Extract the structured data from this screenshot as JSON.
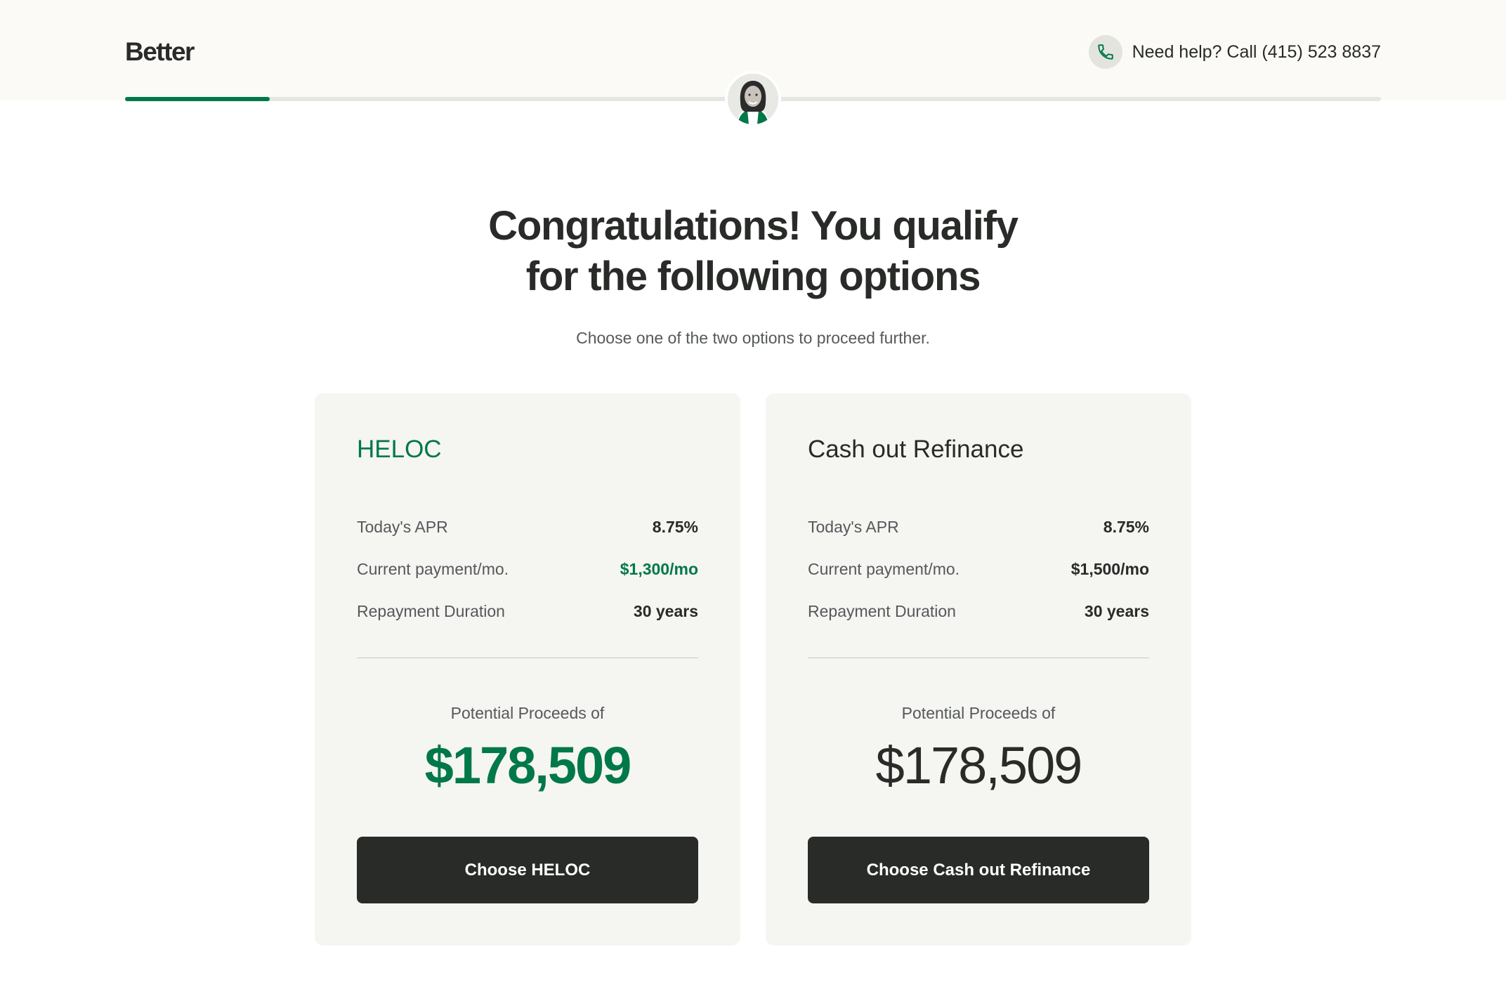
{
  "header": {
    "logo": "Better",
    "help_text": "Need help? Call (415) 523 8837",
    "phone_icon": "phone-icon",
    "avatar_icon": "agent-avatar"
  },
  "progress": {
    "fraction": 0.115,
    "fill_color": "#017848"
  },
  "main": {
    "title_line1": "Congratulations! You qualify",
    "title_line2": "for the following options",
    "subtitle": "Choose one of the two options to proceed further."
  },
  "options": [
    {
      "title": "HELOC",
      "rows": [
        {
          "label": "Today's APR",
          "value": "8.75%"
        },
        {
          "label": "Current payment/mo.",
          "value": "$1,300/mo"
        },
        {
          "label": "Repayment Duration",
          "value": "30 years"
        }
      ],
      "proceeds_label": "Potential Proceeds of",
      "proceeds_value": "$178,509",
      "button_label": "Choose HELOC"
    },
    {
      "title": "Cash out Refinance",
      "rows": [
        {
          "label": "Today's APR",
          "value": "8.75%"
        },
        {
          "label": "Current payment/mo.",
          "value": "$1,500/mo"
        },
        {
          "label": "Repayment Duration",
          "value": "30 years"
        }
      ],
      "proceeds_label": "Potential Proceeds of",
      "proceeds_value": "$178,509",
      "button_label": "Choose Cash out Refinance"
    }
  ],
  "colors": {
    "brand_green": "#017848",
    "dark": "#292b29",
    "card_bg": "#f5f5f2",
    "header_bg": "#fbfaf6"
  }
}
